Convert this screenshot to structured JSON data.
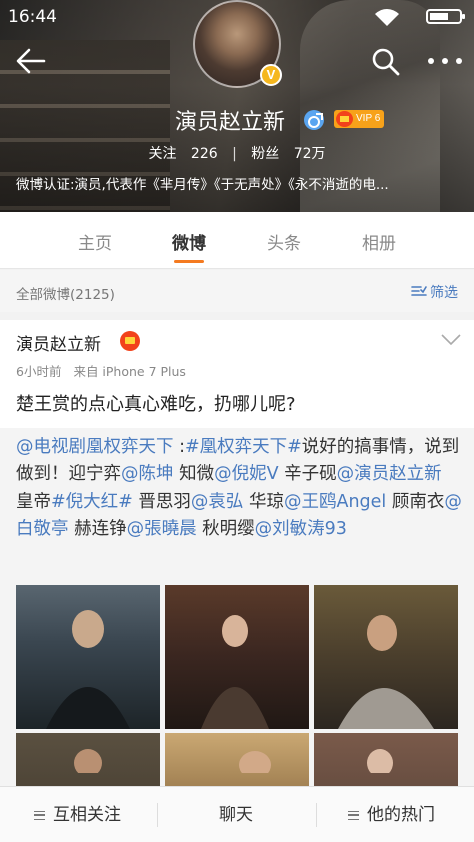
{
  "status_bar": {
    "time": "16:44"
  },
  "profile": {
    "name": "演员赵立新",
    "avatar_badge": "V",
    "vip_level": "VIP 6",
    "following_label": "关注",
    "following_count": "226",
    "followers_label": "粉丝",
    "followers_count": "72万",
    "verification": "微博认证:演员,代表作《芈月传》《于无声处》《永不消逝的电..."
  },
  "tabs": [
    {
      "label": "主页"
    },
    {
      "label": "微博"
    },
    {
      "label": "头条"
    },
    {
      "label": "相册"
    }
  ],
  "active_tab": "微博",
  "filter_bar": {
    "all_posts": "全部微博(2125)",
    "filter_label": "筛选"
  },
  "post": {
    "author": "演员赵立新",
    "time": "6小时前",
    "source": "来自 iPhone 7 Plus",
    "text": "楚王赏的点心真心难吃，扔哪儿呢?",
    "repost_segments": [
      {
        "t": "@电视剧凰权弈天下",
        "link": true
      },
      {
        "t": " :",
        "link": false
      },
      {
        "t": "#凰权弈天下#",
        "link": true
      },
      {
        "t": "说好的搞事情，说到做到！迎宁弈",
        "link": false
      },
      {
        "t": "@陈坤",
        "link": true
      },
      {
        "t": " 知微",
        "link": false
      },
      {
        "t": "@倪妮V",
        "link": true
      },
      {
        "t": " 辛子砚",
        "link": false
      },
      {
        "t": "@演员赵立新",
        "link": true
      },
      {
        "t": " 皇帝",
        "link": false
      },
      {
        "t": "#倪大红#",
        "link": true
      },
      {
        "t": " 晋思羽",
        "link": false
      },
      {
        "t": "@袁弘",
        "link": true
      },
      {
        "t": " 华琼",
        "link": false
      },
      {
        "t": "@王鸥Angel",
        "link": true
      },
      {
        "t": " 顾南衣",
        "link": false
      },
      {
        "t": "@白敬亭",
        "link": true
      },
      {
        "t": " 赫连铮",
        "link": false
      },
      {
        "t": "@張曉晨",
        "link": true
      },
      {
        "t": " 秋明缨",
        "link": false
      },
      {
        "t": "@刘敏涛93",
        "link": true
      }
    ]
  },
  "bottom_bar": {
    "mutual": "互相关注",
    "chat": "聊天",
    "hot": "他的热门"
  },
  "colors": {
    "accent": "#f47a20",
    "link": "#4a7bbf",
    "vip": "#f7a21a"
  },
  "icons": [
    "back-arrow-icon",
    "search-icon",
    "more-icon",
    "wifi-icon",
    "battery-icon",
    "male-gender-icon",
    "vip-crown-icon",
    "filter-icon",
    "chevron-down-icon",
    "menu-icon"
  ]
}
